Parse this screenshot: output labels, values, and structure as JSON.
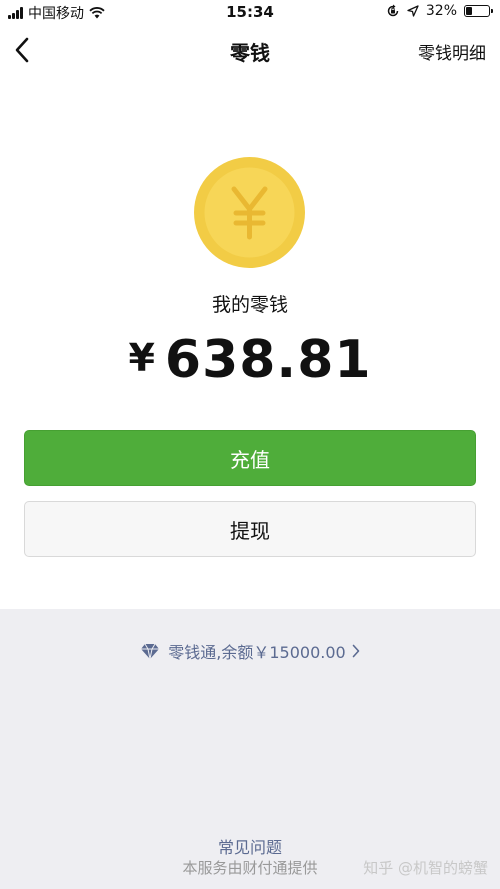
{
  "status_bar": {
    "carrier": "中国移动",
    "time": "15:34",
    "battery_percent": "32%",
    "battery_level": 0.32
  },
  "nav": {
    "title": "零钱",
    "action": "零钱明细"
  },
  "wallet": {
    "label": "我的零钱",
    "currency": "¥",
    "amount": "638.81"
  },
  "buttons": {
    "recharge": "充值",
    "withdraw": "提现"
  },
  "fund": {
    "text": "零钱通,余额￥15000.00"
  },
  "footer": {
    "faq": "常见问题",
    "provider": "本服务由财付通提供",
    "watermark": "知乎 @机智的螃蟹"
  },
  "colors": {
    "accent_green": "#4fad3a",
    "link_blue": "#5b6a91",
    "coin_gold": "#f2cc45"
  },
  "icons": [
    "signal-icon",
    "wifi-icon",
    "lock-rotation-icon",
    "location-arrow-icon",
    "battery-icon",
    "back-icon",
    "yen-coin-icon",
    "diamond-icon",
    "chevron-right-icon"
  ]
}
